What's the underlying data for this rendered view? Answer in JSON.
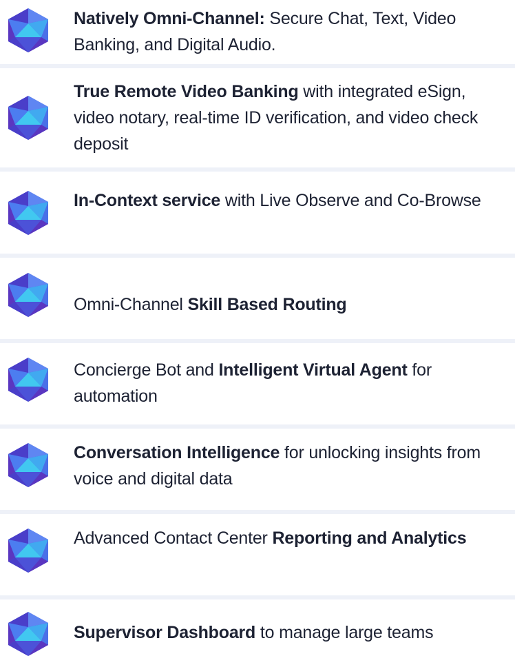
{
  "features": [
    {
      "bold_lead": "Natively Omni-Channel:",
      "text": " Secure Chat, Text, Video Banking, and Digital Audio."
    },
    {
      "bold_lead": "True Remote Video Banking",
      "text": " with integrated eSign, video notary, real-time ID verification, and video check deposit"
    },
    {
      "bold_lead": "In-Context service",
      "text": " with Live Observe and Co-Browse"
    },
    {
      "plain_lead": "Omni-Channel ",
      "bold_trail": "Skill Based Routing"
    },
    {
      "plain_lead": "Concierge Bot and ",
      "bold_mid": "Intelligent Virtual Agent",
      "text": " for automation"
    },
    {
      "bold_lead": "Conversation Intelligence",
      "text": " for unlocking insights from voice and digital data"
    },
    {
      "plain_lead": "Advanced Contact Center ",
      "bold_trail": "Reporting and Analytics"
    },
    {
      "bold_lead": "Supervisor Dashboard",
      "text": " to manage large teams"
    }
  ],
  "colors": {
    "icon_dark": "#4a3ec9",
    "icon_mid": "#4c7df0",
    "icon_light": "#41c8f0",
    "divider": "#eef1f8",
    "text": "#1d2233"
  },
  "icon": "hexagon-gem-icon"
}
